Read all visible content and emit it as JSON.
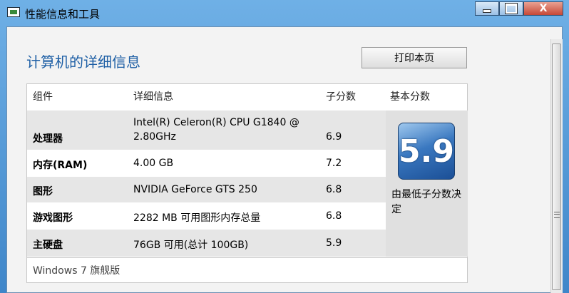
{
  "window": {
    "title": "性能信息和工具",
    "close_glyph": "X"
  },
  "page": {
    "title": "计算机的详细信息",
    "print_label": "打印本页"
  },
  "table": {
    "headers": [
      "组件",
      "详细信息",
      "子分数",
      "基本分数"
    ],
    "rows": [
      {
        "component": "处理器",
        "detail1": "Intel(R) Celeron(R) CPU G1840 @",
        "detail2": "2.80GHz",
        "score": "6.9"
      },
      {
        "component": "内存(RAM)",
        "detail1": "4.00 GB",
        "score": "7.2"
      },
      {
        "component": "图形",
        "detail1": "NVIDIA GeForce GTS 250",
        "score": "6.8"
      },
      {
        "component": "游戏图形",
        "detail1": "2282 MB 可用图形内存总量",
        "score": "6.8"
      },
      {
        "component": "主硬盘",
        "detail1": "76GB 可用(总计 100GB)",
        "score": "5.9"
      }
    ]
  },
  "base_score": {
    "value": "5.9",
    "note": "由最低子分数决定"
  },
  "edition": "Windows 7 旗舰版",
  "colors": {
    "title_blue": "#1e5fa5",
    "row_gray": "#e6e6e6",
    "badge_blue": "#3a78c0"
  }
}
